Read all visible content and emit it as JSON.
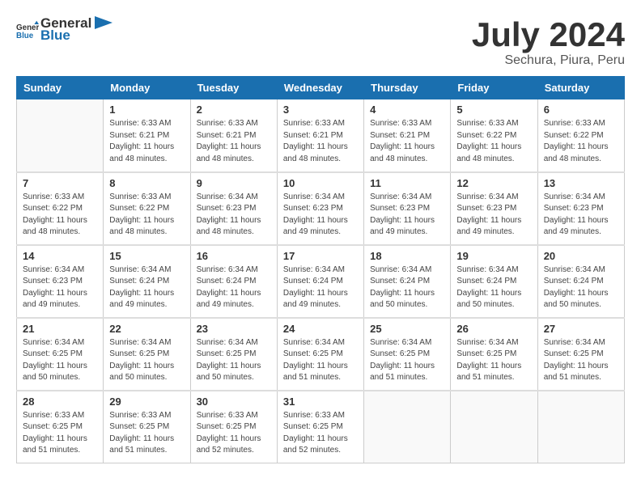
{
  "header": {
    "logo": {
      "general": "General",
      "blue": "Blue"
    },
    "title": "July 2024",
    "subtitle": "Sechura, Piura, Peru"
  },
  "weekdays": [
    "Sunday",
    "Monday",
    "Tuesday",
    "Wednesday",
    "Thursday",
    "Friday",
    "Saturday"
  ],
  "weeks": [
    [
      {
        "day": null
      },
      {
        "day": 1,
        "sunrise": "6:33 AM",
        "sunset": "6:21 PM",
        "daylight": "11 hours and 48 minutes."
      },
      {
        "day": 2,
        "sunrise": "6:33 AM",
        "sunset": "6:21 PM",
        "daylight": "11 hours and 48 minutes."
      },
      {
        "day": 3,
        "sunrise": "6:33 AM",
        "sunset": "6:21 PM",
        "daylight": "11 hours and 48 minutes."
      },
      {
        "day": 4,
        "sunrise": "6:33 AM",
        "sunset": "6:21 PM",
        "daylight": "11 hours and 48 minutes."
      },
      {
        "day": 5,
        "sunrise": "6:33 AM",
        "sunset": "6:22 PM",
        "daylight": "11 hours and 48 minutes."
      },
      {
        "day": 6,
        "sunrise": "6:33 AM",
        "sunset": "6:22 PM",
        "daylight": "11 hours and 48 minutes."
      }
    ],
    [
      {
        "day": 7,
        "sunrise": "6:33 AM",
        "sunset": "6:22 PM",
        "daylight": "11 hours and 48 minutes."
      },
      {
        "day": 8,
        "sunrise": "6:33 AM",
        "sunset": "6:22 PM",
        "daylight": "11 hours and 48 minutes."
      },
      {
        "day": 9,
        "sunrise": "6:34 AM",
        "sunset": "6:23 PM",
        "daylight": "11 hours and 48 minutes."
      },
      {
        "day": 10,
        "sunrise": "6:34 AM",
        "sunset": "6:23 PM",
        "daylight": "11 hours and 49 minutes."
      },
      {
        "day": 11,
        "sunrise": "6:34 AM",
        "sunset": "6:23 PM",
        "daylight": "11 hours and 49 minutes."
      },
      {
        "day": 12,
        "sunrise": "6:34 AM",
        "sunset": "6:23 PM",
        "daylight": "11 hours and 49 minutes."
      },
      {
        "day": 13,
        "sunrise": "6:34 AM",
        "sunset": "6:23 PM",
        "daylight": "11 hours and 49 minutes."
      }
    ],
    [
      {
        "day": 14,
        "sunrise": "6:34 AM",
        "sunset": "6:23 PM",
        "daylight": "11 hours and 49 minutes."
      },
      {
        "day": 15,
        "sunrise": "6:34 AM",
        "sunset": "6:24 PM",
        "daylight": "11 hours and 49 minutes."
      },
      {
        "day": 16,
        "sunrise": "6:34 AM",
        "sunset": "6:24 PM",
        "daylight": "11 hours and 49 minutes."
      },
      {
        "day": 17,
        "sunrise": "6:34 AM",
        "sunset": "6:24 PM",
        "daylight": "11 hours and 49 minutes."
      },
      {
        "day": 18,
        "sunrise": "6:34 AM",
        "sunset": "6:24 PM",
        "daylight": "11 hours and 50 minutes."
      },
      {
        "day": 19,
        "sunrise": "6:34 AM",
        "sunset": "6:24 PM",
        "daylight": "11 hours and 50 minutes."
      },
      {
        "day": 20,
        "sunrise": "6:34 AM",
        "sunset": "6:24 PM",
        "daylight": "11 hours and 50 minutes."
      }
    ],
    [
      {
        "day": 21,
        "sunrise": "6:34 AM",
        "sunset": "6:25 PM",
        "daylight": "11 hours and 50 minutes."
      },
      {
        "day": 22,
        "sunrise": "6:34 AM",
        "sunset": "6:25 PM",
        "daylight": "11 hours and 50 minutes."
      },
      {
        "day": 23,
        "sunrise": "6:34 AM",
        "sunset": "6:25 PM",
        "daylight": "11 hours and 50 minutes."
      },
      {
        "day": 24,
        "sunrise": "6:34 AM",
        "sunset": "6:25 PM",
        "daylight": "11 hours and 51 minutes."
      },
      {
        "day": 25,
        "sunrise": "6:34 AM",
        "sunset": "6:25 PM",
        "daylight": "11 hours and 51 minutes."
      },
      {
        "day": 26,
        "sunrise": "6:34 AM",
        "sunset": "6:25 PM",
        "daylight": "11 hours and 51 minutes."
      },
      {
        "day": 27,
        "sunrise": "6:34 AM",
        "sunset": "6:25 PM",
        "daylight": "11 hours and 51 minutes."
      }
    ],
    [
      {
        "day": 28,
        "sunrise": "6:33 AM",
        "sunset": "6:25 PM",
        "daylight": "11 hours and 51 minutes."
      },
      {
        "day": 29,
        "sunrise": "6:33 AM",
        "sunset": "6:25 PM",
        "daylight": "11 hours and 51 minutes."
      },
      {
        "day": 30,
        "sunrise": "6:33 AM",
        "sunset": "6:25 PM",
        "daylight": "11 hours and 52 minutes."
      },
      {
        "day": 31,
        "sunrise": "6:33 AM",
        "sunset": "6:25 PM",
        "daylight": "11 hours and 52 minutes."
      },
      {
        "day": null
      },
      {
        "day": null
      },
      {
        "day": null
      }
    ]
  ]
}
